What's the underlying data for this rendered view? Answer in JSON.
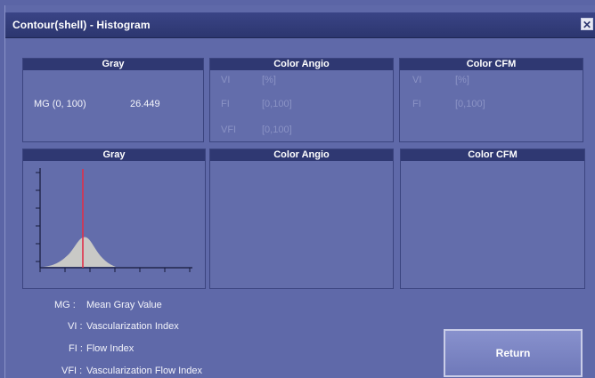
{
  "window": {
    "title": "Contour(shell) - Histogram",
    "close_symbol": "✕"
  },
  "stats": {
    "gray": {
      "title": "Gray",
      "mg_label": "MG (0, 100)",
      "mg_value": "26.449"
    },
    "color_angio": {
      "title": "Color Angio",
      "rows": [
        {
          "label": "VI",
          "value": "[%]"
        },
        {
          "label": "FI",
          "value": "[0,100]"
        },
        {
          "label": "VFI",
          "value": "[0,100]"
        }
      ]
    },
    "color_cfm": {
      "title": "Color CFM",
      "rows": [
        {
          "label": "VI",
          "value": "[%]"
        },
        {
          "label": "FI",
          "value": "[0,100]"
        }
      ]
    }
  },
  "histograms": {
    "gray": {
      "title": "Gray",
      "marker_color": "#e0304a",
      "fill_color": "#c9c9c6"
    },
    "color_angio": {
      "title": "Color Angio"
    },
    "color_cfm": {
      "title": "Color CFM"
    }
  },
  "legend": [
    {
      "abbr": "MG :",
      "text": "Mean Gray Value"
    },
    {
      "abbr": "VI :",
      "text": "Vascularization Index"
    },
    {
      "abbr": "FI :",
      "text": "Flow Index"
    },
    {
      "abbr": "VFI :",
      "text": "Vascularization Flow Index"
    }
  ],
  "buttons": {
    "return_label": "Return"
  }
}
